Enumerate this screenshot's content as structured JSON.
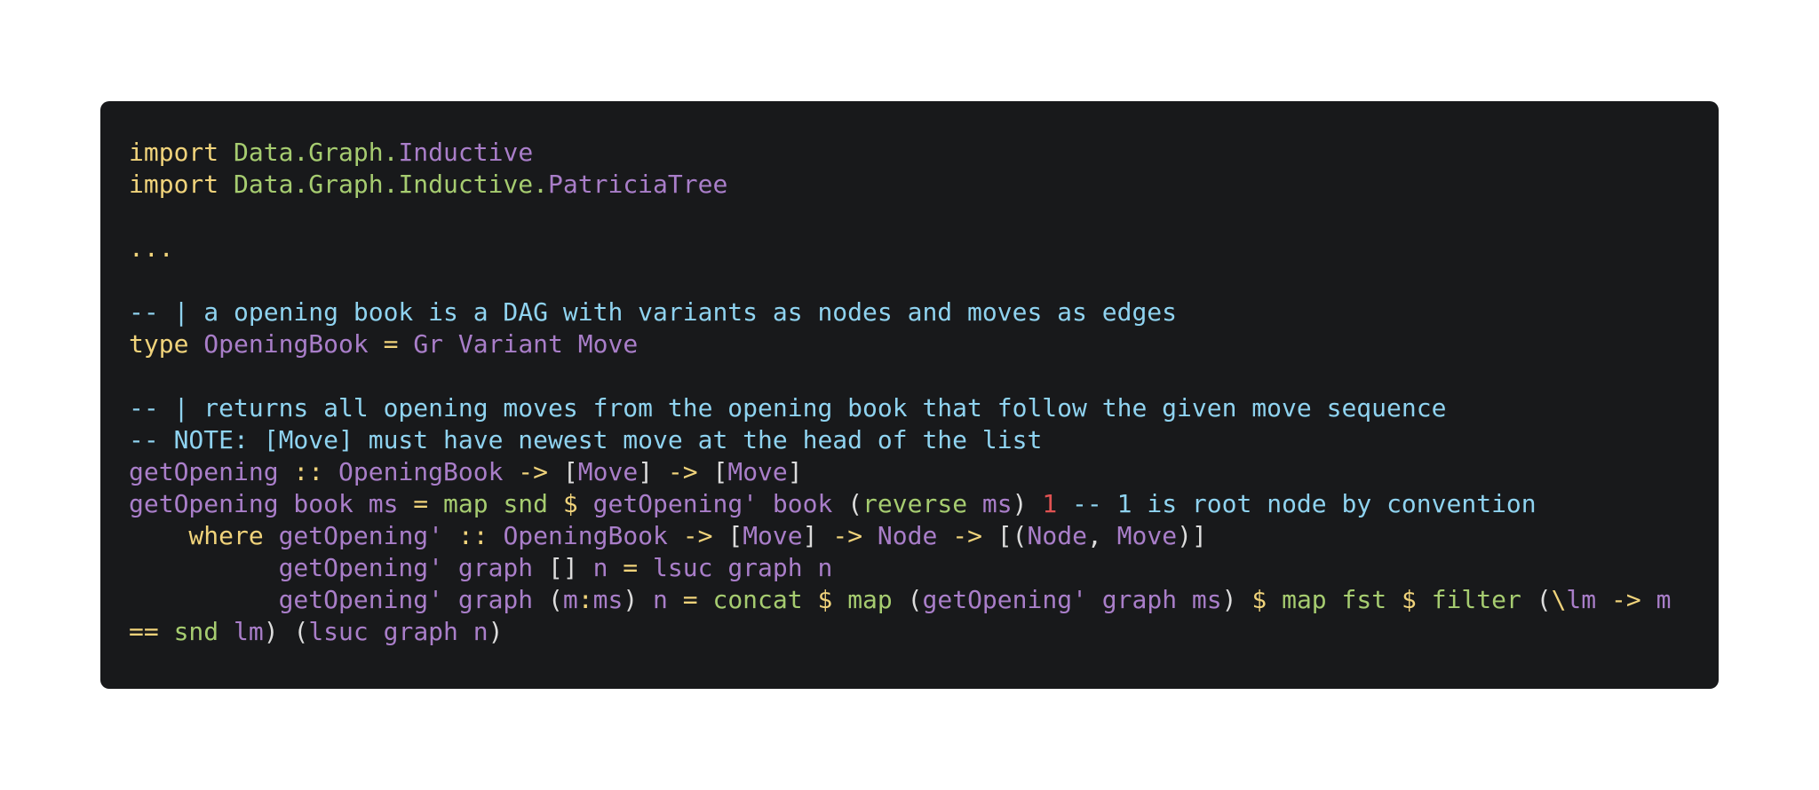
{
  "code": {
    "language": "haskell",
    "lines": [
      [
        {
          "t": "import ",
          "c": "kw"
        },
        {
          "t": "Data.Graph.",
          "c": "mod"
        },
        {
          "t": "Inductive",
          "c": "typ"
        }
      ],
      [
        {
          "t": "import ",
          "c": "kw"
        },
        {
          "t": "Data.Graph.Inductive.",
          "c": "mod"
        },
        {
          "t": "PatriciaTree",
          "c": "typ"
        }
      ],
      [],
      [
        {
          "t": "...",
          "c": "op"
        }
      ],
      [],
      [
        {
          "t": "-- | a opening book is a DAG with variants as nodes and moves as edges",
          "c": "cm"
        }
      ],
      [
        {
          "t": "type ",
          "c": "kw"
        },
        {
          "t": "OpeningBook",
          "c": "typ"
        },
        {
          "t": " = ",
          "c": "op"
        },
        {
          "t": "Gr Variant Move",
          "c": "typ"
        }
      ],
      [],
      [
        {
          "t": "-- | returns all opening moves from the opening book that follow the given move sequence",
          "c": "cm"
        }
      ],
      [
        {
          "t": "-- NOTE: [Move] must have newest move at the head of the list",
          "c": "cm"
        }
      ],
      [
        {
          "t": "getOpening",
          "c": "var"
        },
        {
          "t": " :: ",
          "c": "op"
        },
        {
          "t": "OpeningBook",
          "c": "typ"
        },
        {
          "t": " -> ",
          "c": "op"
        },
        {
          "t": "[",
          "c": "pn"
        },
        {
          "t": "Move",
          "c": "typ"
        },
        {
          "t": "]",
          "c": "pn"
        },
        {
          "t": " -> ",
          "c": "op"
        },
        {
          "t": "[",
          "c": "pn"
        },
        {
          "t": "Move",
          "c": "typ"
        },
        {
          "t": "]",
          "c": "pn"
        }
      ],
      [
        {
          "t": "getOpening book ms",
          "c": "var"
        },
        {
          "t": " = ",
          "c": "op"
        },
        {
          "t": "map snd",
          "c": "fn"
        },
        {
          "t": " $ ",
          "c": "op"
        },
        {
          "t": "getOpening' book ",
          "c": "var"
        },
        {
          "t": "(",
          "c": "pn"
        },
        {
          "t": "reverse ",
          "c": "fn"
        },
        {
          "t": "ms",
          "c": "var"
        },
        {
          "t": ") ",
          "c": "pn"
        },
        {
          "t": "1",
          "c": "num"
        },
        {
          "t": " -- 1 is root node by convention",
          "c": "cm"
        }
      ],
      [
        {
          "t": "    where ",
          "c": "kw"
        },
        {
          "t": "getOpening'",
          "c": "var"
        },
        {
          "t": " :: ",
          "c": "op"
        },
        {
          "t": "OpeningBook",
          "c": "typ"
        },
        {
          "t": " -> ",
          "c": "op"
        },
        {
          "t": "[",
          "c": "pn"
        },
        {
          "t": "Move",
          "c": "typ"
        },
        {
          "t": "]",
          "c": "pn"
        },
        {
          "t": " -> ",
          "c": "op"
        },
        {
          "t": "Node",
          "c": "typ"
        },
        {
          "t": " -> ",
          "c": "op"
        },
        {
          "t": "[(",
          "c": "pn"
        },
        {
          "t": "Node",
          "c": "typ"
        },
        {
          "t": ", ",
          "c": "pn"
        },
        {
          "t": "Move",
          "c": "typ"
        },
        {
          "t": ")]",
          "c": "pn"
        }
      ],
      [
        {
          "t": "          getOpening' graph ",
          "c": "var"
        },
        {
          "t": "[] ",
          "c": "pn"
        },
        {
          "t": "n",
          "c": "var"
        },
        {
          "t": " = ",
          "c": "op"
        },
        {
          "t": "lsuc graph n",
          "c": "var"
        }
      ],
      [
        {
          "t": "          getOpening' graph ",
          "c": "var"
        },
        {
          "t": "(",
          "c": "pn"
        },
        {
          "t": "m",
          "c": "var"
        },
        {
          "t": ":",
          "c": "op"
        },
        {
          "t": "ms",
          "c": "var"
        },
        {
          "t": ") ",
          "c": "pn"
        },
        {
          "t": "n",
          "c": "var"
        },
        {
          "t": " = ",
          "c": "op"
        },
        {
          "t": "concat",
          "c": "fn"
        },
        {
          "t": " $ ",
          "c": "op"
        },
        {
          "t": "map ",
          "c": "fn"
        },
        {
          "t": "(",
          "c": "pn"
        },
        {
          "t": "getOpening' graph ms",
          "c": "var"
        },
        {
          "t": ") ",
          "c": "pn"
        },
        {
          "t": "$ ",
          "c": "op"
        },
        {
          "t": "map fst",
          "c": "fn"
        },
        {
          "t": " $ ",
          "c": "op"
        },
        {
          "t": "filter ",
          "c": "fn"
        },
        {
          "t": "(",
          "c": "pn"
        },
        {
          "t": "\\",
          "c": "op"
        },
        {
          "t": "lm",
          "c": "var"
        },
        {
          "t": " -> ",
          "c": "op"
        },
        {
          "t": "m",
          "c": "var"
        }
      ],
      [
        {
          "t": "==",
          "c": "op"
        },
        {
          "t": " snd ",
          "c": "fn"
        },
        {
          "t": "lm",
          "c": "var"
        },
        {
          "t": ") (",
          "c": "pn"
        },
        {
          "t": "lsuc graph n",
          "c": "var"
        },
        {
          "t": ")",
          "c": "pn"
        }
      ]
    ]
  }
}
